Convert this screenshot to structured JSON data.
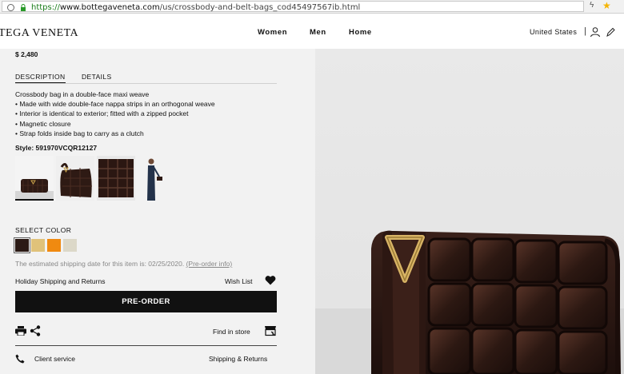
{
  "browser": {
    "url_scheme": "https://",
    "url_domain": "www.bottegaveneta.com",
    "url_path": "/us/crossbody-and-belt-bags_cod45497567ib.html"
  },
  "header": {
    "logo": "TEGA VENETA",
    "nav": [
      "Women",
      "Men",
      "Home"
    ],
    "region": "United States",
    "separator": "|"
  },
  "product": {
    "price": "$ 2,480",
    "tabs": [
      "DESCRIPTION",
      "DETAILS"
    ],
    "description": [
      "Crossbody bag in a double-face maxi weave",
      "• Made with wide double-face nappa strips in an orthogonal weave",
      "• Interior is identical to exterior; fitted with a zipped pocket",
      "• Magnetic closure",
      "• Strap folds inside bag to carry as a clutch"
    ],
    "style": "Style: 591970VCQR12127",
    "select_color_label": "SELECT COLOR",
    "colors": [
      "#2b1a15",
      "#e0c27a",
      "#f08a10",
      "#dcd8c8"
    ],
    "shipping_text": "The estimated shipping date for this item is: 02/25/2020.",
    "preorder_info": "(Pre-order info)",
    "holiday": "Holiday Shipping and Returns",
    "wishlist": "Wish List",
    "preorder_button": "PRE-ORDER",
    "find_in_store": "Find in store",
    "client_service": "Client service",
    "shipping_returns": "Shipping & Returns"
  },
  "icons": [
    "globe-icon",
    "lock-icon",
    "bolt-icon",
    "star-icon",
    "user-icon",
    "pen-icon",
    "heart-icon",
    "print-icon",
    "share-icon",
    "store-icon",
    "phone-icon"
  ]
}
